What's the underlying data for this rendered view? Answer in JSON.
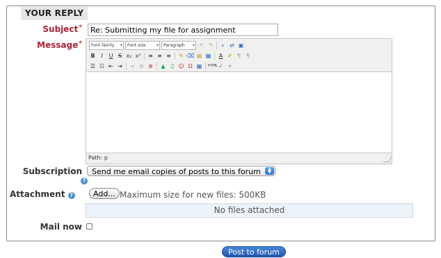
{
  "form": {
    "legend": "YOUR REPLY",
    "required_mark": "*",
    "subject": {
      "label": "Subject",
      "value": "Re: Submitting my file for assignment"
    },
    "message": {
      "label": "Message",
      "toolbar": {
        "font_family": "Font family",
        "font_size": "Font size",
        "paragraph": "Paragraph"
      },
      "path": "Path: p"
    },
    "subscription": {
      "label": "Subscription",
      "selected": "Send me email copies of posts to this forum"
    },
    "attachment": {
      "label": "Attachment",
      "add_button": "Add...",
      "max_size": "Maximum size for new files: 500KB",
      "files_status": "No files attached"
    },
    "mail_now": {
      "label": "Mail now",
      "checked": false
    },
    "submit": "Post to forum"
  }
}
